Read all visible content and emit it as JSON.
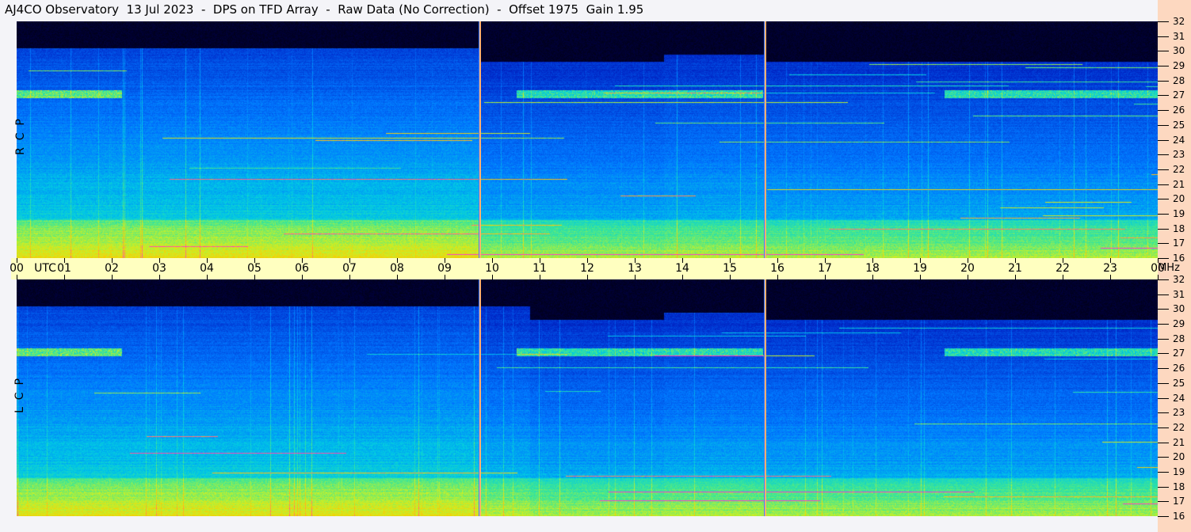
{
  "title": "AJ4CO Observatory  13 Jul 2023  -  DPS on TFD Array  -  Raw Data (No Correction)  -  Offset 1975  Gain 1.95",
  "chart_data": {
    "type": "heatmap",
    "title": "AJ4CO Observatory  13 Jul 2023  -  DPS on TFD Array  -  Raw Data (No Correction)  -  Offset 1975  Gain 1.95",
    "xlabel": "UTC",
    "ylabel": "MHz",
    "xlim": [
      0,
      24
    ],
    "ylim": [
      16,
      32
    ],
    "x_ticks": [
      "00",
      "01",
      "02",
      "03",
      "04",
      "05",
      "06",
      "07",
      "08",
      "09",
      "10",
      "11",
      "12",
      "13",
      "14",
      "15",
      "16",
      "17",
      "18",
      "19",
      "20",
      "21",
      "22",
      "23",
      "00"
    ],
    "y_ticks": [
      32,
      31,
      30,
      29,
      28,
      27,
      26,
      25,
      24,
      23,
      22,
      21,
      20,
      19,
      18,
      17,
      16
    ],
    "panels": [
      {
        "name": "RCP",
        "label": "R  C  P"
      },
      {
        "name": "LCP",
        "label": "L  C  P"
      }
    ],
    "markers_utc": [
      9.73,
      15.73
    ],
    "colormap": [
      "#000000",
      "#000064",
      "#0028c8",
      "#0078ff",
      "#00c8e6",
      "#3ce696",
      "#c8f028",
      "#ffc800",
      "#ff3cc8"
    ]
  }
}
